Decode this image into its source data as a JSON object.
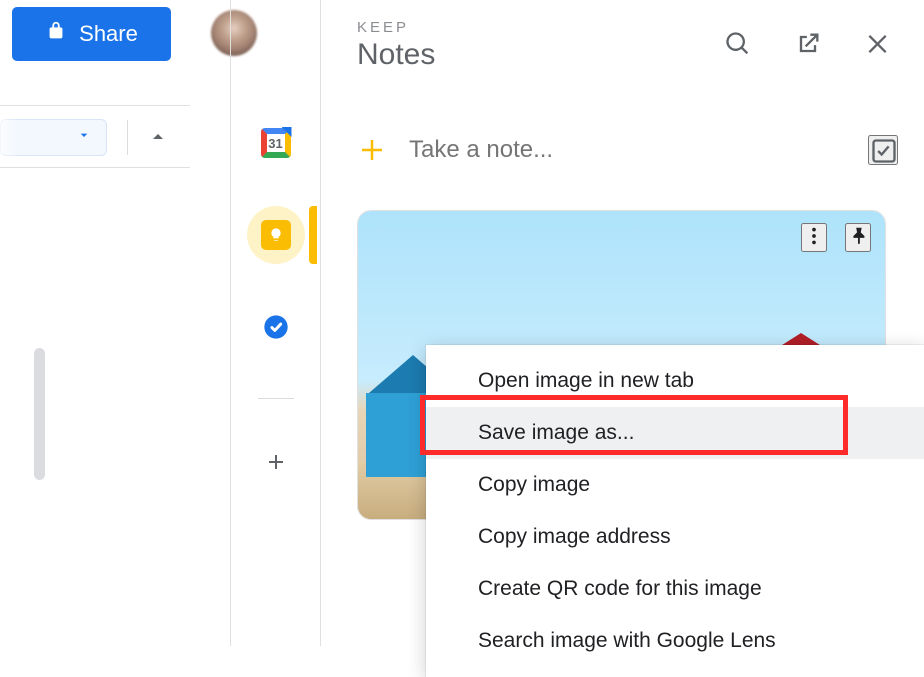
{
  "share_button": {
    "label": "Share"
  },
  "calendar": {
    "day": "31"
  },
  "panel": {
    "eyebrow": "KEEP",
    "title": "Notes",
    "take_note_placeholder": "Take a note..."
  },
  "context_menu": {
    "items": [
      "Open image in new tab",
      "Save image as...",
      "Copy image",
      "Copy image address",
      "Create QR code for this image",
      "Search image with Google Lens"
    ],
    "highlighted_index": 1
  }
}
